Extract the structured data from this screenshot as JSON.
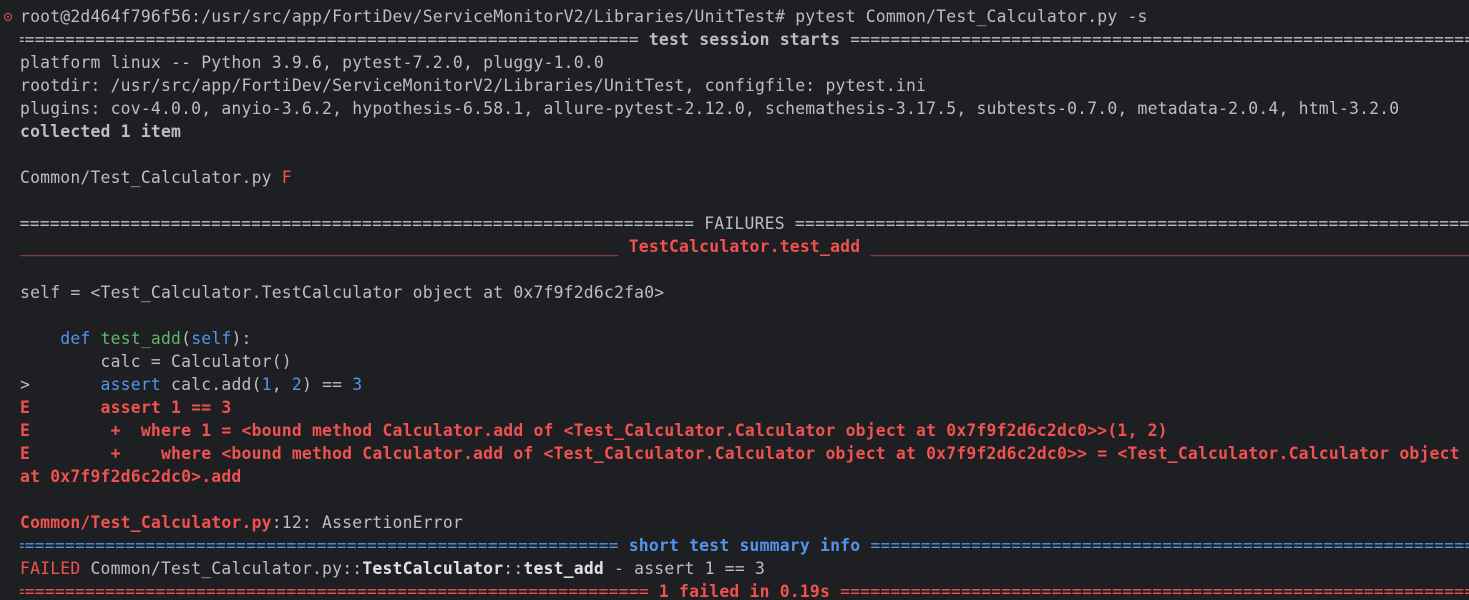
{
  "terminal": {
    "prompt": "root@2d464f796f56:/usr/src/app/FortiDev/ServiceMonitorV2/Libraries/UnitTest# pytest Common/Test_Calculator.py -s",
    "session_header": " test session starts ",
    "platform": "platform linux -- Python 3.9.6, pytest-7.2.0, pluggy-1.0.0",
    "rootdir": "rootdir: /usr/src/app/FortiDev/ServiceMonitorV2/Libraries/UnitTest, configfile: pytest.ini",
    "plugins": "plugins: cov-4.0.0, anyio-3.6.2, hypothesis-6.58.1, allure-pytest-2.12.0, schemathesis-3.17.5, subtests-0.7.0, metadata-2.0.4, html-3.2.0",
    "collected": "collected 1 item",
    "test_file": "Common/Test_Calculator.py ",
    "test_result": "F",
    "failures_header": " FAILURES ",
    "test_header": " TestCalculator.test_add ",
    "self_line": "self = <Test_Calculator.TestCalculator object at 0x7f9f2d6c2fa0>",
    "code": {
      "def_indent": "    ",
      "def_kw": "def",
      "func_name": "test_add",
      "self_kw": "self",
      "def_tail": "):",
      "calc_line": "        calc = Calculator()",
      "assert_prefix": ">       ",
      "assert_kw": "assert",
      "assert_mid": " calc.add(",
      "arg1": "1",
      "arg_sep": ", ",
      "arg2": "2",
      "assert_eq": ") == ",
      "assert_val": "3"
    },
    "errors": [
      "E       assert 1 == 3",
      "E        +  where 1 = <bound method Calculator.add of <Test_Calculator.Calculator object at 0x7f9f2d6c2dc0>>(1, 2)",
      "E        +    where <bound method Calculator.add of <Test_Calculator.Calculator object at 0x7f9f2d6c2dc0>> = <Test_Calculator.Calculator object",
      "at 0x7f9f2d6c2dc0>.add"
    ],
    "location_file": "Common/Test_Calculator.py",
    "location_tail": ":12: AssertionError",
    "summary_header": " short test summary info ",
    "failed_label": "FAILED",
    "failed_path": " Common/Test_Calculator.py::",
    "failed_class": "TestCalculator",
    "failed_sep": "::",
    "failed_test": "test_add",
    "failed_tail": " - assert 1 == 3",
    "final_header": " 1 failed in 0.19s ",
    "rule_eq": "================================================================================================================================================================",
    "rule_dash": "________________________________________________________________________________________________________________________________________________________________",
    "colors": {
      "background": "#1e1f22",
      "text": "#bcbec4",
      "red": "#f0524f",
      "blue": "#5394ec",
      "green": "#5fb865"
    }
  }
}
